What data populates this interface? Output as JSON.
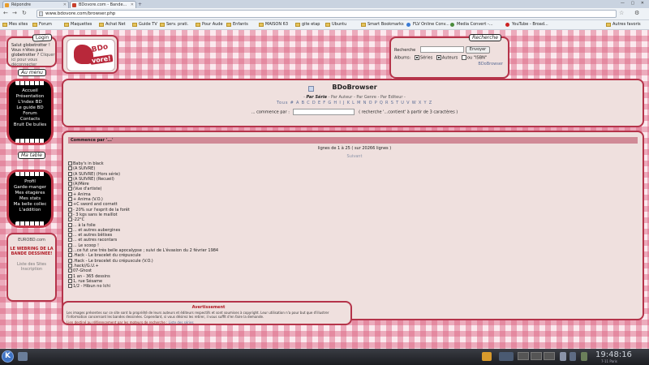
{
  "tabs": [
    {
      "label": "Répondre",
      "active": false
    },
    {
      "label": "BDovore.com - Bande...",
      "active": true
    }
  ],
  "url": "www.bdovore.com/browser.php",
  "bookmarks": [
    "Mes sites",
    "Forum",
    "Maquettes",
    "Achat Net",
    "Guide TV",
    "Serv. prati.",
    "Pour Aude",
    "Enfants",
    "MAISON 63",
    "gite etap",
    "Ubuntu",
    "Smart Bookmarks",
    "FLV Online Conv...",
    "Media Convert -...",
    "YouTube - Broad..."
  ],
  "bookmarks_other": "Autres favoris",
  "login": {
    "title": "Login",
    "line1": "Salut globetrotter !",
    "line2": "Vous n'êtes pas",
    "line3": "globetrotter ?",
    "link": "Cliquer ici pour vous déconnecter"
  },
  "logo": {
    "t1": "BDo",
    "t2": "vore!"
  },
  "search": {
    "title": "Recherche",
    "label": "Recherche",
    "value": "",
    "button": "Envoyer",
    "albums": "Albums",
    "series": "Séries",
    "auteurs": "Auteurs",
    "isbn": "ou \"ISBN\"",
    "brand": "BDoBrowser"
  },
  "menu": {
    "title": "Au menu",
    "items": [
      "Accueil",
      "Présentation",
      "L'index BD",
      "Le guide BD",
      "Forum",
      "Contacts",
      "Bruit De bulles"
    ]
  },
  "table": {
    "title": "Ma table",
    "items": [
      "Profil",
      "Garde-manger",
      "Mes étagères",
      "Mes stats",
      "Ma belle collec",
      "L'addition"
    ]
  },
  "leftinfo": {
    "eurobd": "EUROBD.com",
    "webring1": "LE WEBRING DE LA",
    "webring2": "BANDE DESSINEE!",
    "liste1": "Liste des Sites",
    "liste2": "Inscription"
  },
  "header": {
    "title": "BDoBrowser",
    "by_prefix": "- ",
    "by_serie": "Par Série",
    "by_rest": " - Par Auteur - Par Genre - Par Editeur -",
    "letters": "Tous # A B C D E F G H I J K L M N O P Q R S T U V W X Y Z",
    "search_left": "... commence par :",
    "search_right": "( recherche '...contient' à partir de 3 caractères )"
  },
  "main": {
    "band": "Commence par '...'",
    "info": "lignes de 1 à 25 ( sur 20266 lignes )",
    "next": "Suivant",
    "rows": [
      "Baby's in black",
      "(A SUIVRE)",
      "(A SUIVRE) (Hors série)",
      "(A SUIVRE) (Recueil)",
      "(A)Mère",
      "(Vue d'artiste)",
      "+ Anima",
      "+ Anima (V.O.)",
      "+C sword and cornett",
      "- 20% sur l'esprit de la forêt",
      "- 3 kgs sans le maillot",
      "-22°C",
      "... à la folie",
      "... et autres aubergines",
      "... et autres bêtises",
      "... et autres racontars",
      "... Le scoop !",
      "...ce fut une très belle apocalypse ; suivi de L'évasion du 2 février 1984",
      ".Hack - Le bracelet du crépuscule",
      ".Hack - Le bracelet du crépuscule (V.O.)",
      ".hack//G.U.+",
      "07-Ghost",
      "1 an - 365 dessins",
      "1, rue Sésame",
      "1/2 - Hibun no Ichi"
    ]
  },
  "footer": {
    "heading": "Avertissement",
    "para": "Les images présentes sur ce site sont la propriété de leurs auteurs et éditeurs respectifs et sont soumises à copyright. Leur utilisation n'a pour but que d'illustrer l'information concernant les bandes dessinées. Cependant, si vous désirez les retirer, il vous suffit d'en faire la demande.",
    "para2": "Lien destiné au référencement par les moteurs de recherche : ",
    "para2_link": "Liste des séries"
  },
  "taskbar": {
    "time": "19:48:16",
    "date": "7-11 Paris"
  }
}
